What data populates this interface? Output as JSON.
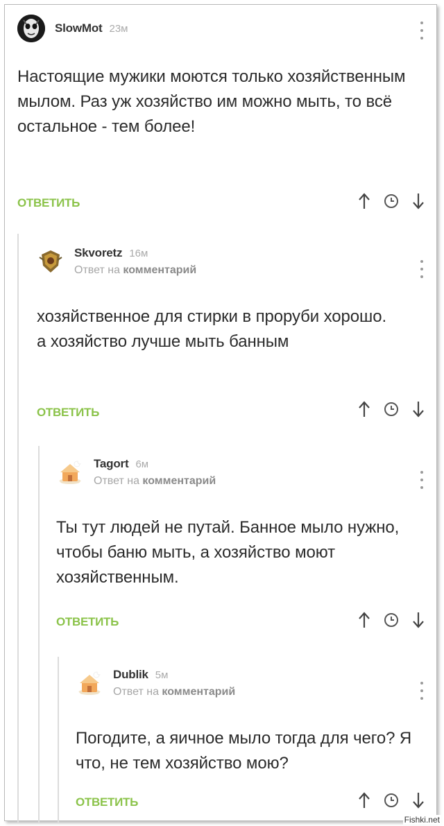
{
  "comments": [
    {
      "author": "SlowMot",
      "time": "23м",
      "reply_to_prefix": "",
      "reply_to_link": "",
      "text": "Настоящие мужики моются только хозяйственным мылом. Раз уж хозяйство им можно мыть, то всё остальное - тем более!",
      "reply_label": "ОТВЕТИТЬ",
      "avatar_icon": "skull-face-avatar"
    },
    {
      "author": "Skvoretz",
      "time": "16м",
      "reply_to_prefix": "Ответ на",
      "reply_to_link": "комментарий",
      "text": "хозяйственное для стирки в проруби хорошо. а хозяйство лучше мыть банным",
      "reply_label": "ОТВЕТИТЬ",
      "avatar_icon": "crest-avatar"
    },
    {
      "author": "Tagort",
      "time": "6м",
      "reply_to_prefix": "Ответ на",
      "reply_to_link": "комментарий",
      "text": "Ты тут людей не путай. Банное мыло нужно, чтобы баню мыть, а хозяйство моют хозяйственным.",
      "reply_label": "ОТВЕТИТЬ",
      "avatar_icon": "default-house-avatar"
    },
    {
      "author": "Dublik",
      "time": "5м",
      "reply_to_prefix": "Ответ на",
      "reply_to_link": "комментарий",
      "text": "Погодите, а яичное мыло тогда для чего? Я что, не тем хозяйство мою?",
      "reply_label": "ОТВЕТИТЬ",
      "avatar_icon": "default-house-avatar"
    }
  ],
  "icons": {
    "upvote": "arrow-up-icon",
    "time": "clock-icon",
    "downvote": "arrow-down-icon",
    "more": "more-vertical-icon"
  },
  "colors": {
    "accent": "#8bc34a",
    "muted": "#a6a6a6",
    "text": "#2b2b2b"
  },
  "watermark": "Fishki.net"
}
